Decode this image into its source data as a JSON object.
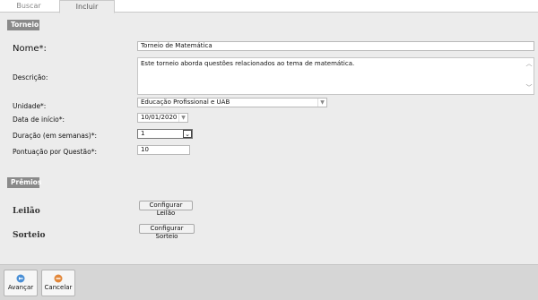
{
  "tabs": {
    "buscar": "Buscar",
    "incluir": "Incluir"
  },
  "sections": {
    "torneio": "Torneio",
    "premios": "Prêmios"
  },
  "form": {
    "nome_label": "Nome*:",
    "nome_value": "Torneio de Matemática",
    "descricao_label": "Descrição:",
    "descricao_value": "Este torneio aborda questões relacionados ao tema de matemática.",
    "unidade_label": "Unidade*:",
    "unidade_value": "Educação Profissional e UAB",
    "data_label": "Data de início*:",
    "data_value": "10/01/2020",
    "duracao_label": "Duração (em semanas)*:",
    "duracao_value": "1",
    "pontuacao_label": "Pontuação por Questão*:",
    "pontuacao_value": "10"
  },
  "premios": {
    "leilao_label": "Leilão",
    "leilao_button": "Configurar Leilão",
    "sorteio_label": "Sorteio",
    "sorteio_button": "Configurar Sorteio"
  },
  "footer": {
    "avancar": "Avançar",
    "cancelar": "Cancelar"
  },
  "icons": {
    "scroll_up": "chevron-up-icon",
    "scroll_down": "chevron-down-icon",
    "dropdown": "chevron-down-icon",
    "avancar": "arrow-right-icon",
    "cancelar": "cancel-icon"
  },
  "colors": {
    "section_header": "#8a8a8a",
    "footer": "#d6d6d6",
    "background": "#ececec"
  }
}
